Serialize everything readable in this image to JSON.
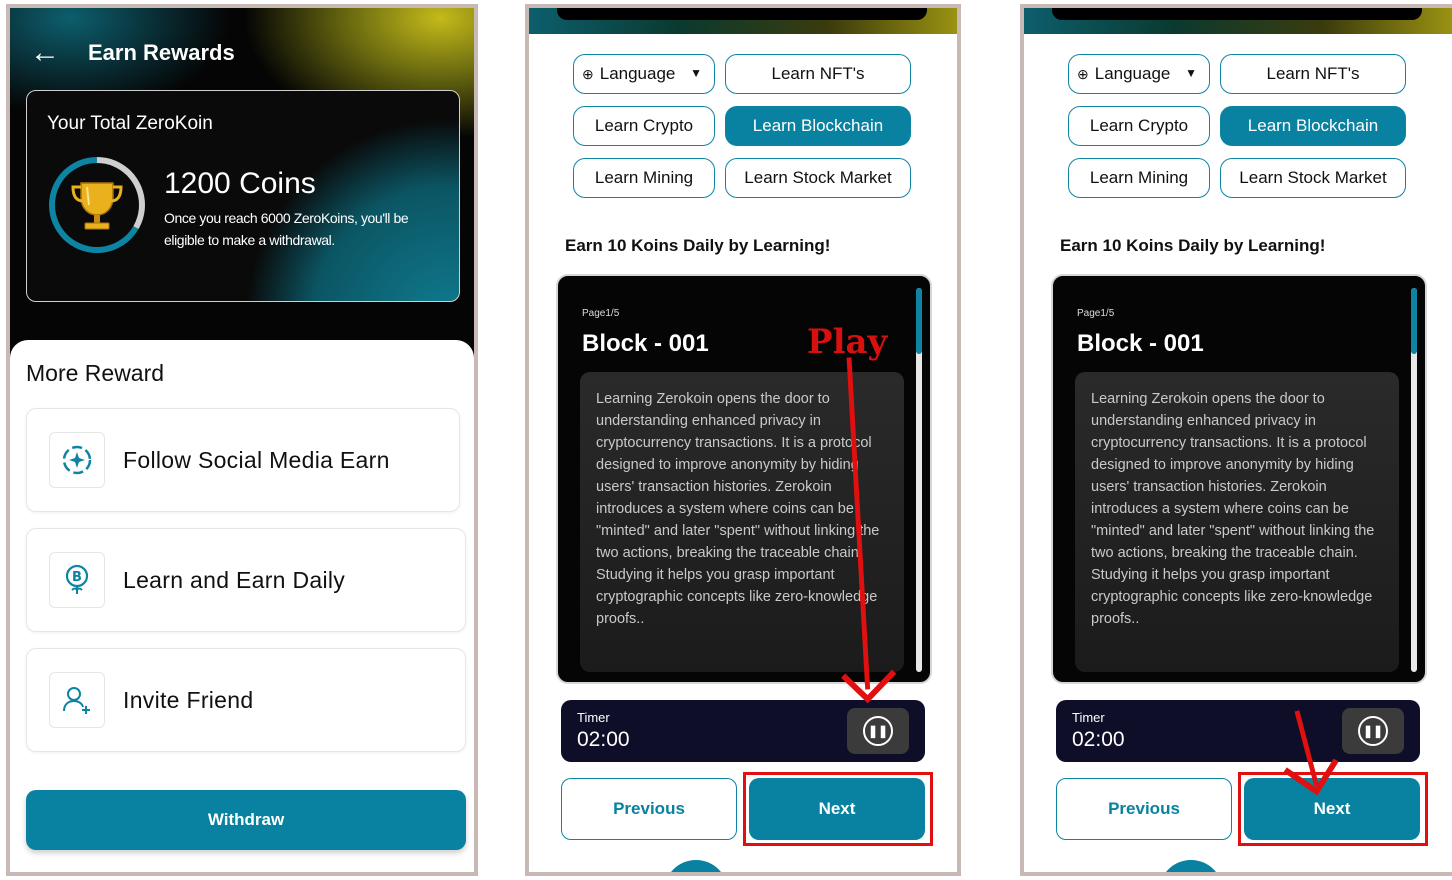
{
  "panel1": {
    "title": "Earn Rewards",
    "back_icon": "←",
    "total_label": "Your Total ZeroKoin",
    "coins": "1200 Coins",
    "note": "Once you reach 6000 ZeroKoins, you'll be eligible to make a withdrawal.",
    "more_title": "More Reward",
    "rewards": [
      {
        "label": "Follow Social Media Earn",
        "icon": "sparkle-circle-icon"
      },
      {
        "label": "Learn and Earn Daily",
        "icon": "bitcoin-badge-icon"
      },
      {
        "label": "Invite Friend",
        "icon": "add-user-icon"
      }
    ],
    "withdraw": "Withdraw"
  },
  "learn": {
    "chips": {
      "language": "Language",
      "nft": "Learn NFT's",
      "crypto": "Learn Crypto",
      "blockchain": "Learn Blockchain",
      "mining": "Learn Mining",
      "stock": "Learn Stock Market"
    },
    "earn_heading": "Earn 10 Koins Daily by Learning!",
    "page": "Page1/5",
    "block": "Block - 001",
    "body": "Learning Zerokoin opens the door to understanding enhanced privacy in cryptocurrency transactions. It is a protocol designed to improve anonymity by hiding users' transaction histories. Zerokoin introduces a system where coins can be \"minted\" and later \"spent\" without linking the two actions, breaking the traceable chain. Studying it helps you grasp important cryptographic concepts like zero-knowledge proofs..",
    "timer_label": "Timer",
    "timer_value": "02:00",
    "previous": "Previous",
    "next": "Next"
  },
  "annotation": {
    "play": "Play",
    "color": "#e01010"
  },
  "colors": {
    "accent": "#0882a0",
    "dark": "#050505",
    "timer_bg": "#0e0e28"
  }
}
